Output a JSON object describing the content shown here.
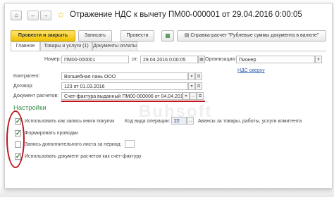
{
  "window": {
    "title": "Отражение НДС к вычету ПМ00-000001 от 29.04.2016 0:00:05"
  },
  "toolbar": {
    "post_close": "Провести и закрыть",
    "save": "Записать",
    "post": "Провести",
    "report": "Справка-расчет \"Рублевые суммы документа в валюте\""
  },
  "tabs": [
    "Главное",
    "Товары и услуги (1)",
    "Документы оплаты"
  ],
  "form": {
    "number_label": "Номер:",
    "number_value": "ПМ00-000001",
    "date_from_label": "от:",
    "date_value": "29.04.2016  0:00:05",
    "org_label": "Организация:",
    "org_value": "Пионер",
    "vat_link": "НДС сверху",
    "counterparty_label": "Контрагент:",
    "counterparty_value": "Волшебная лань ООО",
    "contract_label": "Договор:",
    "contract_value": "123 от 01.03.2016",
    "settlement_label": "Документ расчетов:",
    "settlement_value": "Счет-фактура выданный ПМ00-000006 от 04.04.201"
  },
  "settings": {
    "header": "Настройки",
    "use_as_purchase_book": "Использовать как запись книги покупок",
    "operation_code_label": "Код вида операции:",
    "operation_code_value": "22",
    "operation_code_desc": "Авансы за товары, работы, услуги комитента",
    "form_entries": "Формировать проводки",
    "additional_sheet": "Запись дополнительного листа за период:",
    "use_settlement_as_invoice": "Использовать документ расчетов как счет-фактуру"
  },
  "checkbox_states": {
    "use_as_purchase_book": true,
    "form_entries": true,
    "additional_sheet": false,
    "use_settlement_as_invoice": true
  },
  "watermark": "Buhsoft",
  "colors": {
    "primary_button": "#f2c200",
    "section_header": "#3f8f52",
    "annotation": "#c0141c"
  }
}
